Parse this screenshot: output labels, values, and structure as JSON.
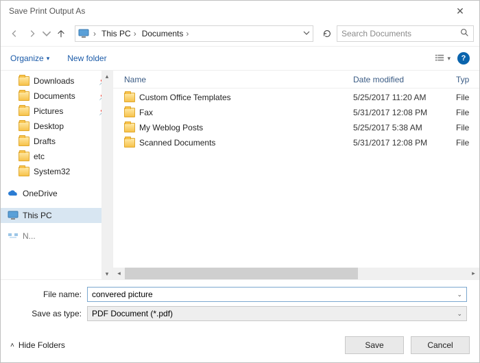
{
  "window": {
    "title": "Save Print Output As"
  },
  "nav": {
    "breadcrumb": [
      "This PC",
      "Documents"
    ],
    "search_placeholder": "Search Documents"
  },
  "toolbar": {
    "organize": "Organize",
    "new_folder": "New folder"
  },
  "sidebar": {
    "items": [
      {
        "label": "Downloads",
        "pinned": true
      },
      {
        "label": "Documents",
        "pinned": true
      },
      {
        "label": "Pictures",
        "pinned": true
      },
      {
        "label": "Desktop",
        "pinned": false
      },
      {
        "label": "Drafts",
        "pinned": false
      },
      {
        "label": "etc",
        "pinned": false
      },
      {
        "label": "System32",
        "pinned": false
      }
    ],
    "onedrive": "OneDrive",
    "thispc": "This PC"
  },
  "columns": {
    "name": "Name",
    "date": "Date modified",
    "type": "Typ"
  },
  "files": [
    {
      "name": "Custom Office Templates",
      "date": "5/25/2017 11:20 AM",
      "type": "File"
    },
    {
      "name": "Fax",
      "date": "5/31/2017 12:08 PM",
      "type": "File"
    },
    {
      "name": "My Weblog Posts",
      "date": "5/25/2017 5:38 AM",
      "type": "File"
    },
    {
      "name": "Scanned Documents",
      "date": "5/31/2017 12:08 PM",
      "type": "File"
    }
  ],
  "form": {
    "filename_label": "File name:",
    "filename_value": "convered picture",
    "type_label": "Save as type:",
    "type_value": "PDF Document (*.pdf)"
  },
  "footer": {
    "hide_folders": "Hide Folders",
    "save": "Save",
    "cancel": "Cancel"
  }
}
